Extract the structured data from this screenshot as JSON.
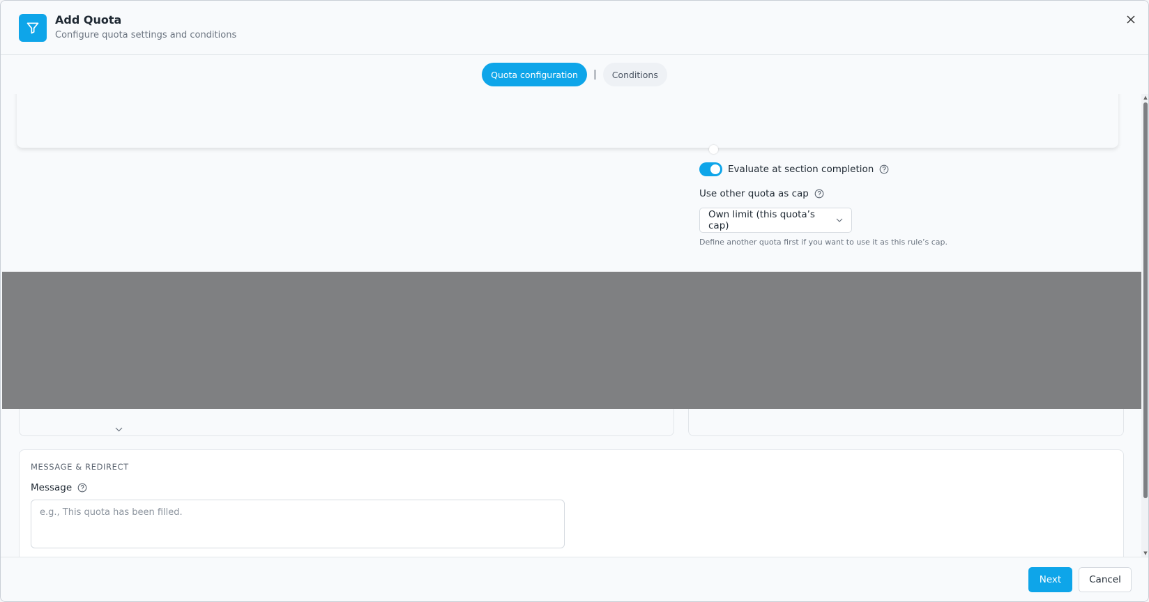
{
  "header": {
    "title": "Add Quota",
    "subtitle": "Configure quota settings and conditions",
    "icon": "filter-icon",
    "accent_color": "#0ea5e9"
  },
  "tabs": [
    {
      "label": "Quota configuration",
      "active": true
    },
    {
      "label": "Conditions",
      "active": false
    }
  ],
  "tab_separator": "|",
  "settings": {
    "evaluate_toggle_label": "Evaluate at section completion",
    "evaluate_toggle_on": true,
    "cap_label": "Use other quota as cap",
    "cap_selected": "Own limit (this quota’s cap)",
    "cap_hint": "Define another quota first if you want to use it as this rule’s cap."
  },
  "message_section": {
    "heading": "MESSAGE & REDIRECT",
    "message_label": "Message",
    "message_placeholder": "e.g., This quota has been filled."
  },
  "footer": {
    "next_label": "Next",
    "cancel_label": "Cancel"
  }
}
